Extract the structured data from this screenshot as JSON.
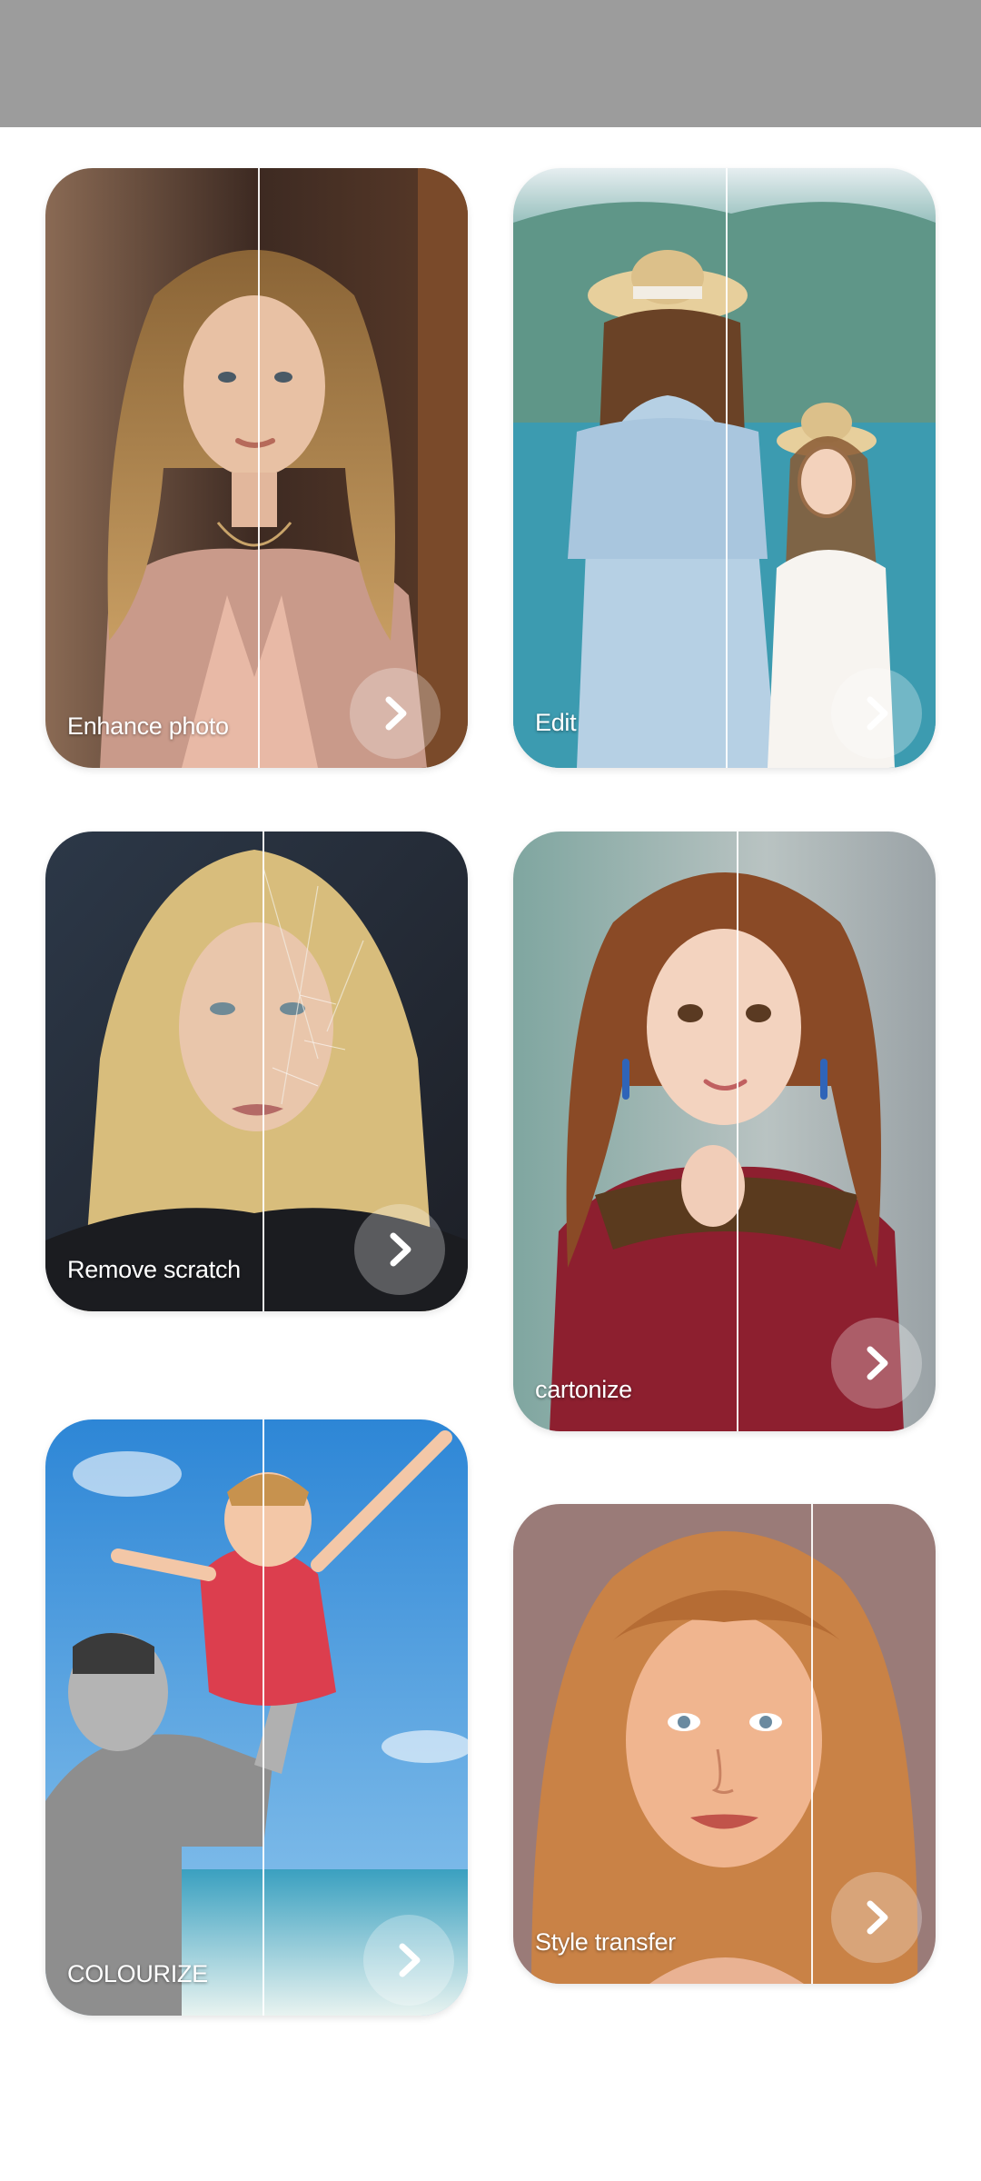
{
  "status_bar": {
    "color": "#9c9c9c"
  },
  "features": [
    {
      "id": "enhance",
      "label": "Enhance photo",
      "icon": "chevron-right-icon"
    },
    {
      "id": "edit",
      "label": "Edit",
      "icon": "chevron-right-icon"
    },
    {
      "id": "scratch",
      "label": "Remove scratch",
      "icon": "chevron-right-icon"
    },
    {
      "id": "cartonize",
      "label": "cartonize",
      "icon": "chevron-right-icon"
    },
    {
      "id": "colourize",
      "label": "COLOURIZE",
      "icon": "chevron-right-icon"
    },
    {
      "id": "style",
      "label": "Style transfer",
      "icon": "chevron-right-icon"
    }
  ]
}
